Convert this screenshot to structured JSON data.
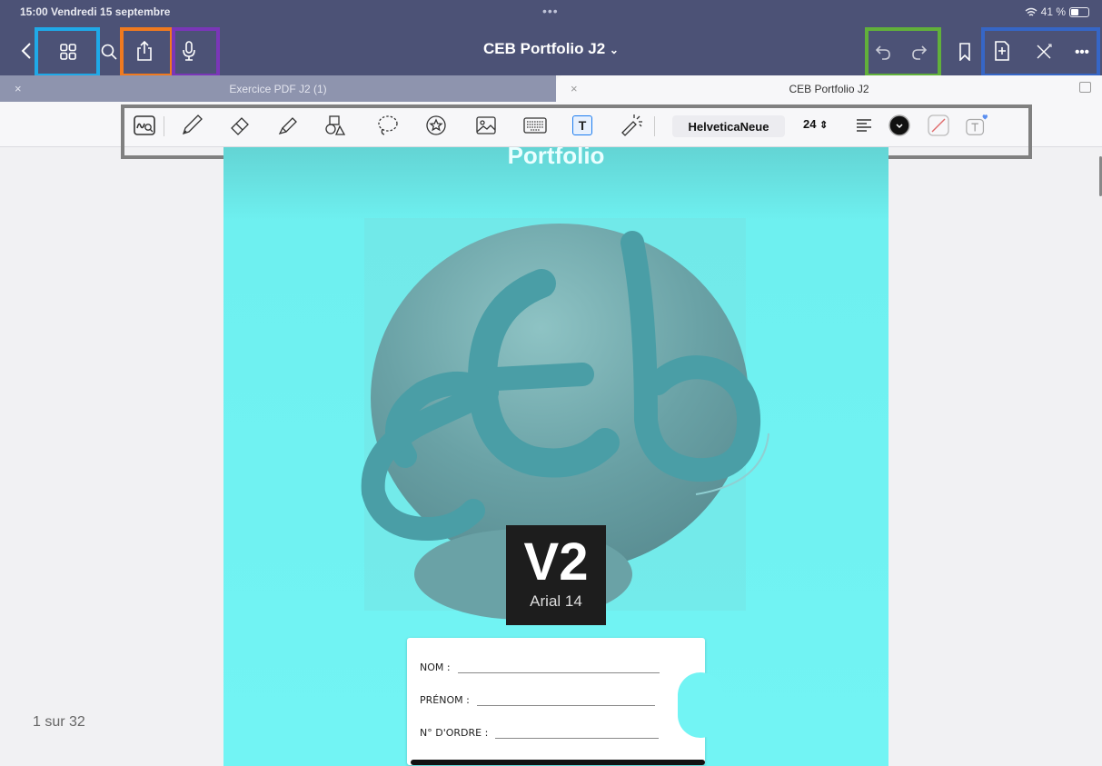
{
  "status_bar": {
    "time_date": "15:00  Vendredi 15 septembre",
    "dots": "•••",
    "battery": "41 %"
  },
  "header": {
    "title": "CEB Portfolio J2",
    "chevron": "⌄",
    "more": "•••"
  },
  "tabs": [
    {
      "label": "Exercice PDF J2 (1)",
      "close": "×"
    },
    {
      "label": "CEB Portfolio J2",
      "close": "×"
    }
  ],
  "toolbar": {
    "font_name": "HelveticaNeue",
    "font_size": "24",
    "text_tool_glyph": "T"
  },
  "page": {
    "heading": "Portfolio",
    "version": "V2",
    "version_note": "Arial 14",
    "fields": [
      "NOM :",
      "PRÉNOM :",
      "N° D'ORDRE :"
    ]
  },
  "page_counter": "1 sur 32",
  "colors": {
    "header_bg": "#4c5276",
    "highlight_lightblue": "#1fa9e8",
    "highlight_orange": "#f07a1f",
    "highlight_purple": "#7a36b8",
    "highlight_green": "#61b03a",
    "highlight_blue": "#3666c6",
    "highlight_gray": "#808080"
  },
  "icons": [
    "back-icon",
    "grid-icon",
    "search-icon",
    "share-icon",
    "microphone-icon",
    "undo-icon",
    "redo-icon",
    "bookmark-icon",
    "add-page-icon",
    "close-x-icon",
    "more-icon"
  ]
}
